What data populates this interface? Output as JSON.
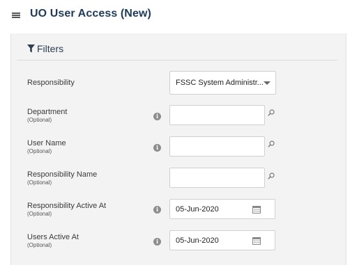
{
  "header": {
    "title": "UO User Access (New)",
    "menu_icon": "hamburger-list-icon"
  },
  "filters": {
    "title": "Filters",
    "icon": "filter-funnel-icon"
  },
  "fields": {
    "responsibility": {
      "label": "Responsibility",
      "value": "FSSC System Administr..."
    },
    "department": {
      "label": "Department",
      "optional": "(Optional)",
      "value": ""
    },
    "user_name": {
      "label": "User Name",
      "optional": "(Optional)",
      "value": ""
    },
    "responsibility_name": {
      "label": "Responsibility Name",
      "optional": "(Optional)",
      "value": ""
    },
    "responsibility_active_at": {
      "label": "Responsibility Active At",
      "optional": "(Optional)",
      "value": "05-Jun-2020"
    },
    "users_active_at": {
      "label": "Users Active At",
      "optional": "(Optional)",
      "value": "05-Jun-2020"
    }
  },
  "colors": {
    "title": "#1f3b57",
    "panel_bg": "#f3f3f3",
    "info_icon": "#8d8d8d"
  }
}
